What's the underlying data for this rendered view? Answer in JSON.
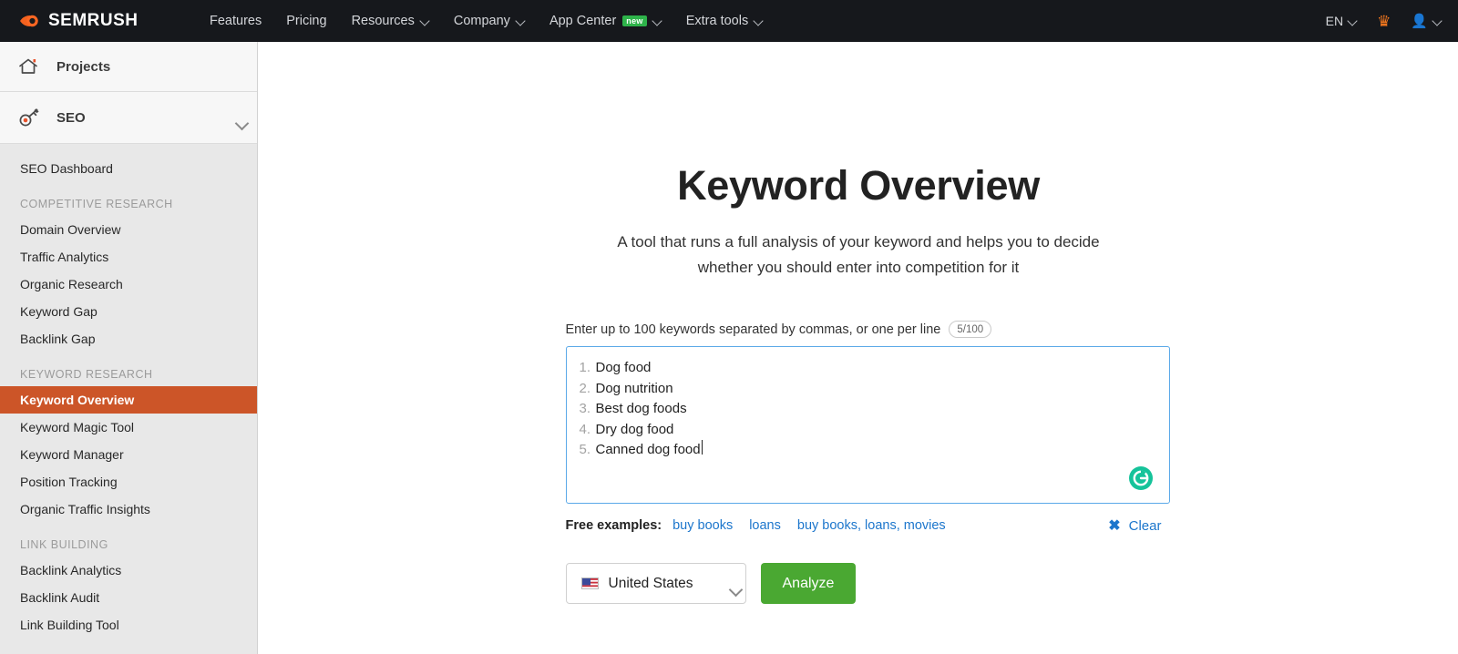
{
  "topnav": {
    "brand": "SEMRUSH",
    "logo_icon": "semrush-comet-icon",
    "items": [
      {
        "label": "Features",
        "has_caret": false,
        "badge": ""
      },
      {
        "label": "Pricing",
        "has_caret": false,
        "badge": ""
      },
      {
        "label": "Resources",
        "has_caret": true,
        "badge": ""
      },
      {
        "label": "Company",
        "has_caret": true,
        "badge": ""
      },
      {
        "label": "App Center",
        "has_caret": true,
        "badge": "new"
      },
      {
        "label": "Extra tools",
        "has_caret": true,
        "badge": ""
      }
    ],
    "language": "EN",
    "crown_icon": "crown-icon",
    "user_icon": "user-avatar-icon"
  },
  "sidebar": {
    "projects": {
      "label": "Projects",
      "icon": "home-icon"
    },
    "seo": {
      "label": "SEO",
      "icon": "key-icon",
      "chevron": "chevron-down-icon"
    },
    "dashboard": "SEO Dashboard",
    "groups": [
      {
        "heading": "COMPETITIVE RESEARCH",
        "items": [
          "Domain Overview",
          "Traffic Analytics",
          "Organic Research",
          "Keyword Gap",
          "Backlink Gap"
        ]
      },
      {
        "heading": "KEYWORD RESEARCH",
        "items": [
          "Keyword Overview",
          "Keyword Magic Tool",
          "Keyword Manager",
          "Position Tracking",
          "Organic Traffic Insights"
        ]
      },
      {
        "heading": "LINK BUILDING",
        "items": [
          "Backlink Analytics",
          "Backlink Audit",
          "Link Building Tool"
        ]
      }
    ],
    "active_item": "Keyword Overview",
    "active_color": "#cc5528"
  },
  "main": {
    "title": "Keyword Overview",
    "subtitle_line1": "A tool that runs a full analysis of your keyword and helps you to decide",
    "subtitle_line2": "whether you should enter into competition for it",
    "field_label": "Enter up to 100 keywords separated by commas, or one per line",
    "counter": "5/100",
    "keywords": [
      {
        "num": "1.",
        "text": "Dog food"
      },
      {
        "num": "2.",
        "text": "Dog nutrition"
      },
      {
        "num": "3.",
        "text": "Best dog foods"
      },
      {
        "num": "4.",
        "text": "Dry dog food"
      },
      {
        "num": "5.",
        "text": "Canned dog food"
      }
    ],
    "grammarly_icon": "grammarly-icon",
    "examples_label": "Free examples:",
    "examples": [
      "buy books",
      "loans",
      "buy books, loans, movies"
    ],
    "clear_label": "Clear",
    "clear_icon": "close-x-icon",
    "country": "United States",
    "country_flag_icon": "us-flag-icon",
    "country_chevron": "chevron-down-icon",
    "analyze_label": "Analyze",
    "analyze_color": "#4aa832",
    "link_color": "#1c76cc",
    "focus_border_color": "#5ba9e8"
  }
}
